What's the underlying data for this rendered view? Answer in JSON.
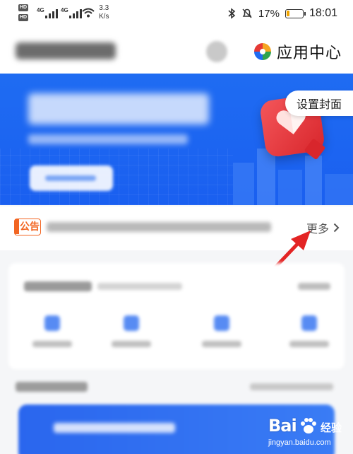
{
  "status_bar": {
    "hd1": "HD",
    "hd2": "HD",
    "sig1": "4G",
    "sig2": "4G",
    "speed_value": "3.3",
    "speed_unit": "K/s",
    "battery_percent": "17%",
    "battery_level": 0.17,
    "time": "18:01"
  },
  "header": {
    "app_center_label": "应用中心"
  },
  "banner": {
    "cover_button_label": "设置封面",
    "accent_color": "#1f6cf2"
  },
  "notice": {
    "badge_label": "公告",
    "more_label": "更多",
    "accent_color": "#f26522"
  },
  "watermark": {
    "brand": "Bai",
    "brand_cn": "经验",
    "url": "jingyan.baidu.com"
  }
}
